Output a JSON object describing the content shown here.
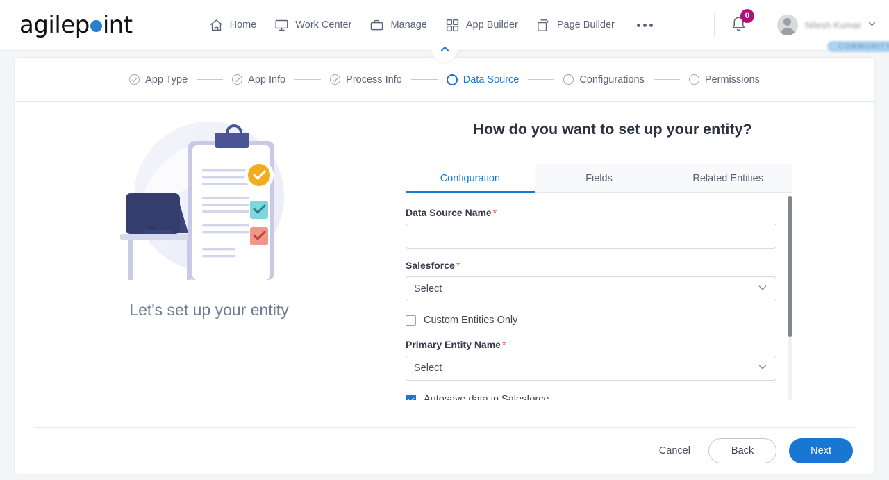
{
  "header": {
    "logo_text_a": "agilep",
    "logo_text_b": "int",
    "nav": [
      {
        "label": "Home",
        "icon": "home-icon"
      },
      {
        "label": "Work Center",
        "icon": "monitor-icon"
      },
      {
        "label": "Manage",
        "icon": "briefcase-icon"
      },
      {
        "label": "App Builder",
        "icon": "grid-icon"
      },
      {
        "label": "Page Builder",
        "icon": "pages-icon"
      }
    ],
    "more_label": "more-menu",
    "notification_count": "0",
    "user_name": "Nilesh Kumar",
    "user_badge": "COMMUNITY",
    "caret": "⌄"
  },
  "stepper": {
    "steps": [
      {
        "label": "App Type",
        "state": "done"
      },
      {
        "label": "App Info",
        "state": "done"
      },
      {
        "label": "Process Info",
        "state": "done"
      },
      {
        "label": "Data Source",
        "state": "active"
      },
      {
        "label": "Configurations",
        "state": "todo"
      },
      {
        "label": "Permissions",
        "state": "todo"
      }
    ]
  },
  "illustration": {
    "caption": "Let's set up your entity"
  },
  "main": {
    "title": "How do you want to set up your entity?",
    "tabs": [
      {
        "label": "Configuration",
        "active": true
      },
      {
        "label": "Fields",
        "active": false
      },
      {
        "label": "Related Entities",
        "active": false
      }
    ],
    "fields": {
      "data_source_name_label": "Data Source Name",
      "data_source_name_value": "",
      "data_source_name_placeholder": "",
      "salesforce_label": "Salesforce",
      "salesforce_value": "Select",
      "custom_entities_label": "Custom Entities Only",
      "custom_entities_checked": false,
      "primary_entity_label": "Primary Entity Name",
      "primary_entity_value": "Select",
      "autosave_label": "Autosave data in Salesforce",
      "autosave_checked": true,
      "required_marker": "*"
    }
  },
  "footer": {
    "cancel_label": "Cancel",
    "back_label": "Back",
    "next_label": "Next"
  },
  "colors": {
    "accent": "#1877d2",
    "badge": "#b4107a",
    "required": "#e2625a",
    "muted_text": "#5a6379"
  }
}
